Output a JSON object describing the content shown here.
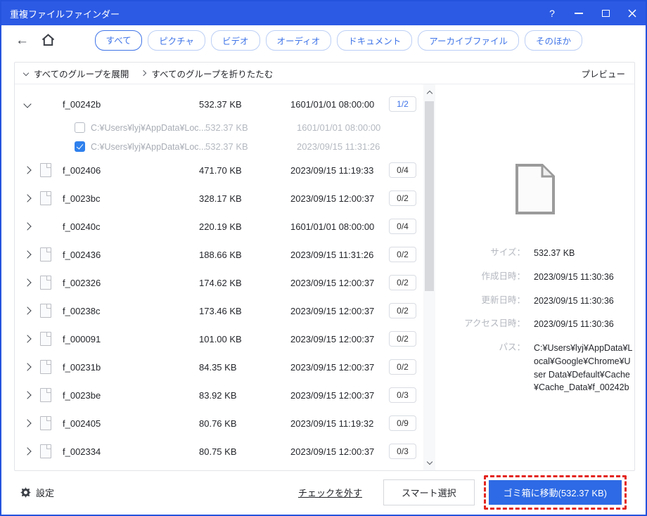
{
  "window": {
    "title": "重複ファイルファインダー",
    "help": "?"
  },
  "toolbar": {
    "back": "←",
    "tabs": [
      {
        "label": "すべて",
        "active": true
      },
      {
        "label": "ピクチャ",
        "active": false
      },
      {
        "label": "ビデオ",
        "active": false
      },
      {
        "label": "オーディオ",
        "active": false
      },
      {
        "label": "ドキュメント",
        "active": false
      },
      {
        "label": "アーカイブファイル",
        "active": false
      },
      {
        "label": "そのほか",
        "active": false
      }
    ]
  },
  "group_bar": {
    "expand_all": "すべてのグループを展開",
    "collapse_all": "すべてのグループを折りたたむ",
    "preview": "プレビュー"
  },
  "file_list": {
    "groups": [
      {
        "name": "f_00242b",
        "size": "532.37 KB",
        "date": "1601/01/01 08:00:00",
        "badge": "1/2",
        "children": [
          {
            "path": "C:¥Users¥lyj¥AppData¥Loc...",
            "size": "532.37 KB",
            "date": "1601/01/01 08:00:00",
            "checked": false
          },
          {
            "path": "C:¥Users¥lyj¥AppData¥Loc...",
            "size": "532.37 KB",
            "date": "2023/09/15 11:31:26",
            "checked": true
          }
        ]
      },
      {
        "name": "f_002406",
        "size": "471.70 KB",
        "date": "2023/09/15 11:19:33",
        "badge": "0/4"
      },
      {
        "name": "f_0023bc",
        "size": "328.17 KB",
        "date": "2023/09/15 12:00:37",
        "badge": "0/2"
      },
      {
        "name": "f_00240c",
        "size": "220.19 KB",
        "date": "1601/01/01 08:00:00",
        "badge": "0/4"
      },
      {
        "name": "f_002436",
        "size": "188.66 KB",
        "date": "2023/09/15 11:31:26",
        "badge": "0/2"
      },
      {
        "name": "f_002326",
        "size": "174.62 KB",
        "date": "2023/09/15 12:00:37",
        "badge": "0/2"
      },
      {
        "name": "f_00238c",
        "size": "173.46 KB",
        "date": "2023/09/15 12:00:37",
        "badge": "0/2"
      },
      {
        "name": "f_000091",
        "size": "101.00 KB",
        "date": "2023/09/15 12:00:37",
        "badge": "0/2"
      },
      {
        "name": "f_00231b",
        "size": "84.35 KB",
        "date": "2023/09/15 12:00:37",
        "badge": "0/2"
      },
      {
        "name": "f_0023be",
        "size": "83.92 KB",
        "date": "2023/09/15 12:00:37",
        "badge": "0/3"
      },
      {
        "name": "f_002405",
        "size": "80.76 KB",
        "date": "2023/09/15 11:19:32",
        "badge": "0/9"
      },
      {
        "name": "f_002334",
        "size": "80.75 KB",
        "date": "2023/09/15 12:00:37",
        "badge": "0/3"
      }
    ]
  },
  "preview_panel": {
    "details": [
      {
        "label": "サイズ：",
        "value": "532.37 KB"
      },
      {
        "label": "作成日時：",
        "value": "2023/09/15 11:30:36"
      },
      {
        "label": "更新日時：",
        "value": "2023/09/15 11:30:36"
      },
      {
        "label": "アクセス日時：",
        "value": "2023/09/15 11:30:36"
      },
      {
        "label": "パス：",
        "value": "C:¥Users¥lyj¥AppData¥Local¥Google¥Chrome¥User Data¥Default¥Cache¥Cache_Data¥f_00242b"
      }
    ]
  },
  "footer": {
    "settings": "設定",
    "uncheck": "チェックを外す",
    "smart_select": "スマート選択",
    "move_to_trash": "ゴミ箱に移動(532.37 KB)"
  },
  "colors": {
    "titlebar_blue": "#2c5ae4",
    "accent_blue": "#2e6ae5",
    "tab_blue": "#3f74e8",
    "checkbox_blue": "#2f80ed",
    "annotation_red": "#e3251f"
  }
}
